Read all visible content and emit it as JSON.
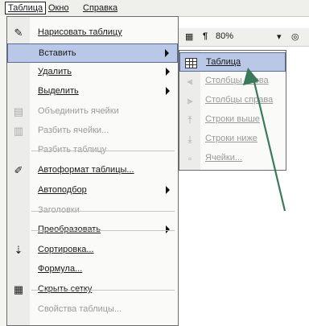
{
  "menubar": {
    "items": [
      "Таблица",
      "Окно",
      "Справка"
    ]
  },
  "toolbar": {
    "pilcrow": "¶",
    "zoom": "80%"
  },
  "table_menu": {
    "items": [
      {
        "label": "Нарисовать таблицу",
        "icon": "pencil-icon"
      },
      {
        "label": "Вставить",
        "icon": "none",
        "submenu": true
      },
      {
        "label": "Удалить",
        "icon": "none",
        "submenu": true
      },
      {
        "label": "Выделить",
        "icon": "none",
        "submenu": true
      },
      {
        "label": "Объединить ячейки",
        "icon": "merge-cells-icon",
        "disabled": true
      },
      {
        "label": "Разбить ячейки...",
        "icon": "split-cells-icon",
        "disabled": true
      },
      {
        "label": "Разбить таблицу",
        "icon": "none",
        "disabled": true
      },
      {
        "label": "Автоформат таблицы...",
        "icon": "autoformat-icon"
      },
      {
        "label": "Автоподбор",
        "icon": "none",
        "submenu": true
      },
      {
        "label": "Заголовки",
        "icon": "none",
        "disabled": true
      },
      {
        "label": "Преобразовать",
        "icon": "none",
        "submenu": true
      },
      {
        "label": "Сортировка...",
        "icon": "sort-az-icon"
      },
      {
        "label": "Формула...",
        "icon": "none"
      },
      {
        "label": "Скрыть сетку",
        "icon": "grid-icon"
      },
      {
        "label": "Свойства таблицы...",
        "icon": "none",
        "disabled": true
      }
    ]
  },
  "insert_submenu": {
    "items": [
      {
        "label": "Таблица",
        "icon": "table-icon"
      },
      {
        "label": "Столбцы слева",
        "icon": "insert-columns-left-icon",
        "disabled": true
      },
      {
        "label": "Столбцы справа",
        "icon": "insert-columns-right-icon",
        "disabled": true
      },
      {
        "label": "Строки выше",
        "icon": "insert-rows-above-icon",
        "disabled": true
      },
      {
        "label": "Строки ниже",
        "icon": "insert-rows-below-icon",
        "disabled": true
      },
      {
        "label": "Ячейки...",
        "icon": "insert-cells-icon",
        "disabled": true
      }
    ]
  },
  "colors": {
    "highlight": "#b9c8e6",
    "highlight_border": "#5b6d97",
    "pointer_arrow": "#3a7a5a"
  }
}
